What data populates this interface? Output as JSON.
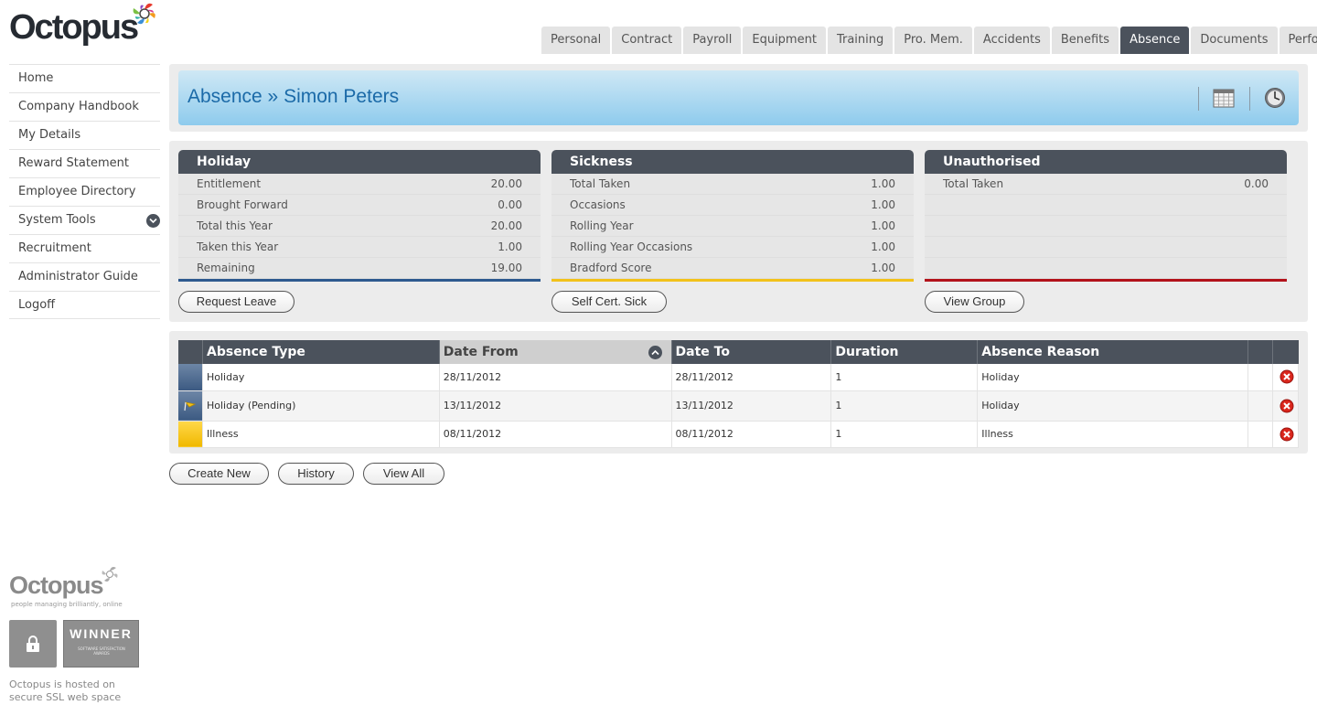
{
  "brand": {
    "name": "Octopus",
    "tagline": "people managing brilliantly, online"
  },
  "tabs": [
    {
      "label": "Personal",
      "active": false
    },
    {
      "label": "Contract",
      "active": false
    },
    {
      "label": "Payroll",
      "active": false
    },
    {
      "label": "Equipment",
      "active": false
    },
    {
      "label": "Training",
      "active": false
    },
    {
      "label": "Pro. Mem.",
      "active": false
    },
    {
      "label": "Accidents",
      "active": false
    },
    {
      "label": "Benefits",
      "active": false
    },
    {
      "label": "Absence",
      "active": true
    },
    {
      "label": "Documents",
      "active": false
    },
    {
      "label": "Perform",
      "active": false
    }
  ],
  "sidebar": {
    "items": [
      {
        "label": "Home"
      },
      {
        "label": "Company Handbook"
      },
      {
        "label": "My Details"
      },
      {
        "label": "Reward Statement"
      },
      {
        "label": "Employee Directory"
      },
      {
        "label": "System Tools",
        "expandable": true
      },
      {
        "label": "Recruitment"
      },
      {
        "label": "Administrator Guide"
      },
      {
        "label": "Logoff"
      }
    ]
  },
  "header": {
    "title": "Absence » Simon Peters",
    "icons": [
      "calendar-icon",
      "clock-icon"
    ]
  },
  "summary": {
    "holiday": {
      "title": "Holiday",
      "accent": "#2e5a8f",
      "rows": [
        {
          "label": "Entitlement",
          "value": "20.00"
        },
        {
          "label": "Brought Forward",
          "value": "0.00"
        },
        {
          "label": "Total this Year",
          "value": "20.00"
        },
        {
          "label": "Taken this Year",
          "value": "1.00"
        },
        {
          "label": "Remaining",
          "value": "19.00"
        }
      ],
      "button": "Request Leave"
    },
    "sickness": {
      "title": "Sickness",
      "accent": "#f2c21a",
      "rows": [
        {
          "label": "Total Taken",
          "value": "1.00"
        },
        {
          "label": "Occasions",
          "value": "1.00"
        },
        {
          "label": "Rolling Year",
          "value": "1.00"
        },
        {
          "label": "Rolling Year Occasions",
          "value": "1.00"
        },
        {
          "label": "Bradford Score",
          "value": "1.00"
        }
      ],
      "button": "Self Cert. Sick"
    },
    "unauthorised": {
      "title": "Unauthorised",
      "accent": "#b3121a",
      "rows": [
        {
          "label": "Total Taken",
          "value": "0.00"
        },
        {
          "label": "",
          "value": ""
        },
        {
          "label": "",
          "value": ""
        },
        {
          "label": "",
          "value": ""
        },
        {
          "label": "",
          "value": ""
        }
      ],
      "button": "View Group"
    }
  },
  "absence_table": {
    "columns": [
      "Absence Type",
      "Date From",
      "Date To",
      "Duration",
      "Absence Reason"
    ],
    "sorted_column": "Date From",
    "rows": [
      {
        "type": "Holiday",
        "from": "28/11/2012",
        "to": "28/11/2012",
        "duration": "1",
        "reason": "Holiday",
        "swatch": "holiday"
      },
      {
        "type": "Holiday (Pending)",
        "from": "13/11/2012",
        "to": "13/11/2012",
        "duration": "1",
        "reason": "Holiday",
        "swatch": "pending"
      },
      {
        "type": "Illness",
        "from": "08/11/2012",
        "to": "08/11/2012",
        "duration": "1",
        "reason": "Illness",
        "swatch": "illness"
      }
    ]
  },
  "actions": {
    "create_new": "Create New",
    "history": "History",
    "view_all": "View All"
  },
  "footer": {
    "badge_title": "WINNER",
    "badge_sub": "SOFTWARE SATISFACTION AWARDS",
    "ssl_note": "Octopus is hosted on secure SSL web space"
  }
}
